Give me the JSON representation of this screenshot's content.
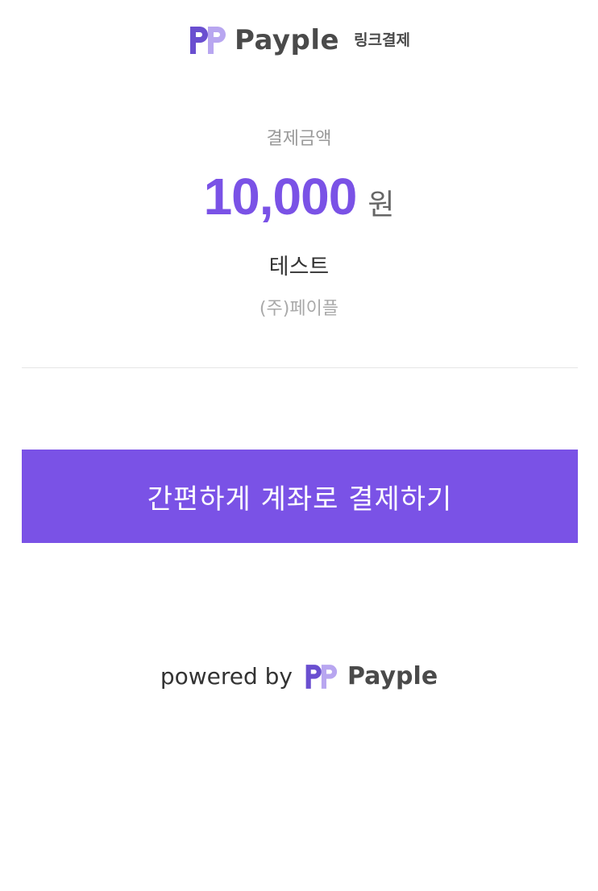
{
  "header": {
    "brand_name": "Payple",
    "brand_tag": "링크결제",
    "logo_icon": "payple-logo-icon"
  },
  "payment": {
    "amount_label": "결제금액",
    "amount_value": "10,000",
    "amount_unit": "원",
    "product_name": "테스트",
    "seller_name": "(주)페이플"
  },
  "actions": {
    "pay_button_label": "간편하게 계좌로 결제하기"
  },
  "footer": {
    "powered_text": "powered by",
    "brand_name": "Payple",
    "logo_icon": "payple-logo-icon"
  },
  "colors": {
    "accent": "#7a52e6",
    "logo_dark": "#6a4fd0",
    "logo_light": "#b8a6f0",
    "text_dark": "#333333",
    "text_muted": "#9a9a9a",
    "divider": "#e6e6e6",
    "background": "#ffffff"
  }
}
